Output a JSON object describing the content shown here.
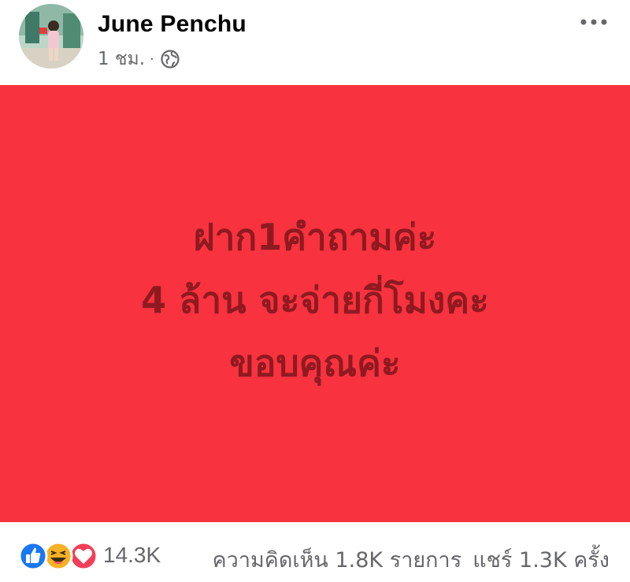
{
  "post": {
    "author": "June Penchu",
    "timestamp": "1 ชม.",
    "separator": "·",
    "privacy_icon": "globe-icon",
    "more_icon": "more-options-icon",
    "background_color": "#f8323f",
    "text_color": "#8e1a1f",
    "text_lines": [
      "ฝาก1คำถามค่ะ",
      "4 ล้าน จะจ่ายกี่โมงคะ",
      "ขอบคุณค่ะ"
    ]
  },
  "footer": {
    "reaction_icons": [
      "like-icon",
      "haha-icon",
      "love-icon"
    ],
    "reaction_count": "14.3K",
    "comments": "ความคิดเห็น 1.8K รายการ",
    "shares": "แชร์ 1.3K ครั้ง"
  }
}
